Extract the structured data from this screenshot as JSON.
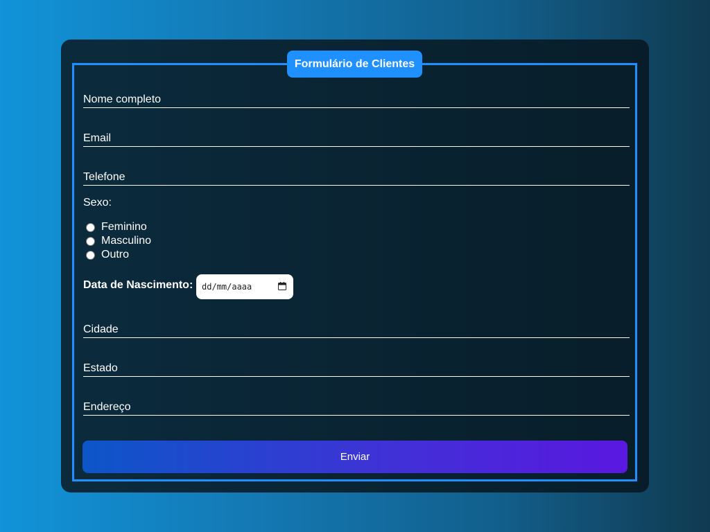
{
  "form": {
    "title": "Formulário de Clientes",
    "fields": {
      "nome": {
        "placeholder": "Nome completo",
        "value": ""
      },
      "email": {
        "placeholder": "Email",
        "value": ""
      },
      "telefone": {
        "placeholder": "Telefone",
        "value": ""
      },
      "cidade": {
        "placeholder": "Cidade",
        "value": ""
      },
      "estado": {
        "placeholder": "Estado",
        "value": ""
      },
      "endereco": {
        "placeholder": "Endereço",
        "value": ""
      }
    },
    "sexo": {
      "label": "Sexo:",
      "options": [
        "Feminino",
        "Masculino",
        "Outro"
      ],
      "selected": null
    },
    "nascimento": {
      "label": "Data de Nascimento:",
      "placeholder": "dd/mm/aaaa",
      "icon": "calendar-icon"
    },
    "submit_label": "Enviar"
  },
  "colors": {
    "accent": "#1e90ff",
    "card_bg": "#0a2433",
    "button_start": "#0c56c8",
    "button_end": "#5a18e0"
  }
}
